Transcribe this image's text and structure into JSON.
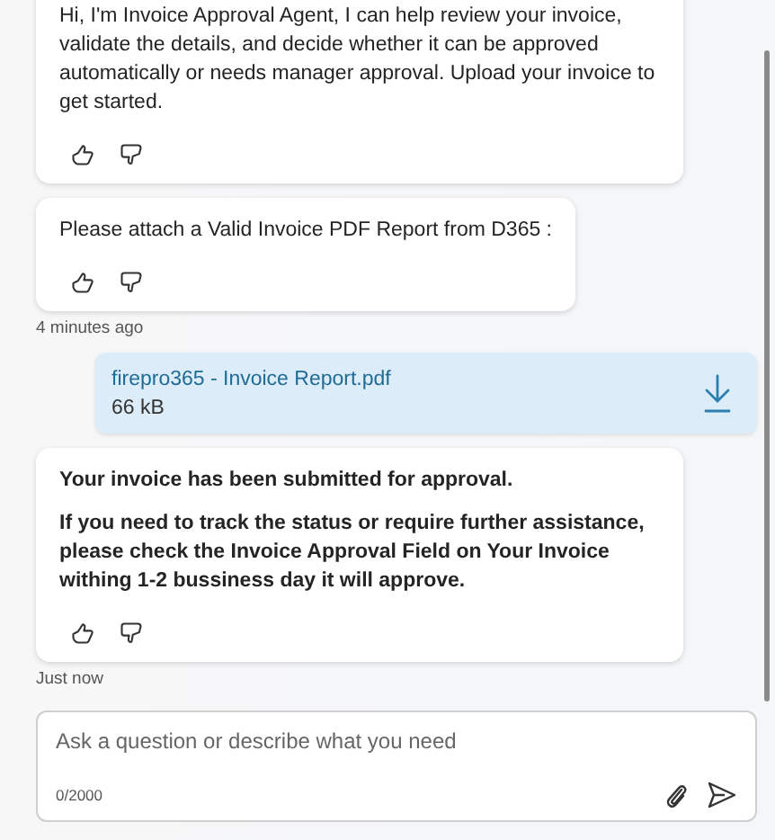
{
  "messages": [
    {
      "kind": "bot",
      "bold": false,
      "paragraphs": [
        "Hi, I'm Invoice Approval Agent, I can help review your invoice, validate the details, and decide whether it can be approved automatically or needs manager approval. Upload your invoice to get started."
      ]
    },
    {
      "kind": "bot",
      "bold": false,
      "paragraphs": [
        "Please attach a Valid Invoice PDF Report from D365 :"
      ],
      "timestamp": "4 minutes ago"
    },
    {
      "kind": "file",
      "name": "firepro365 - Invoice Report.pdf",
      "size": "66 kB"
    },
    {
      "kind": "bot",
      "bold": true,
      "paragraphs": [
        "Your invoice has been submitted for approval.",
        "If you need to track the status or require further assistance, please check the Invoice Approval Field on Your Invoice withing 1-2 bussiness day it will approve."
      ],
      "timestamp": "Just now"
    }
  ],
  "composer": {
    "placeholder": "Ask a question or describe what you need",
    "counter": "0/2000"
  }
}
